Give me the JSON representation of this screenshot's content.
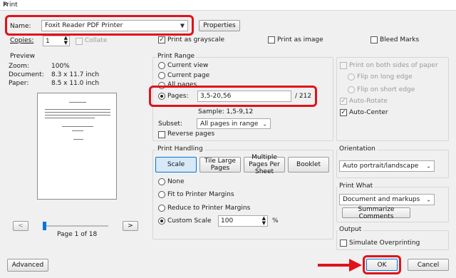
{
  "window": {
    "title": "Print",
    "close": "✕"
  },
  "printer": {
    "name_label": "Name:",
    "name_value": "Foxit Reader PDF Printer",
    "properties_label": "Properties",
    "copies_label": "Copies:",
    "copies_value": "1",
    "collate_label": "Collate",
    "grayscale_label": "Print as grayscale",
    "image_label": "Print as image",
    "bleed_label": "Bleed Marks"
  },
  "preview": {
    "title": "Preview",
    "zoom_label": "Zoom:",
    "zoom_value": "100%",
    "document_label": "Document:",
    "document_value": "8.3 x 11.7 inch",
    "paper_label": "Paper:",
    "paper_value": "8.5 x 11.0 inch",
    "prev_label": "<",
    "next_label": ">",
    "page_indicator": "Page 1 of 18"
  },
  "print_range": {
    "title": "Print Range",
    "current_view": "Current view",
    "current_page": "Current page",
    "all_pages": "All pages",
    "pages_label": "Pages:",
    "pages_value": "3,5-20,56",
    "pages_total": "/ 212",
    "sample": "Sample: 1,5-9,12",
    "subset_label": "Subset:",
    "subset_value": "All pages in range",
    "reverse_label": "Reverse pages"
  },
  "duplex": {
    "both_sides": "Print on both sides of paper",
    "long_edge": "Flip on long edge",
    "short_edge": "Flip on short edge",
    "auto_rotate": "Auto-Rotate",
    "auto_center": "Auto-Center"
  },
  "handling": {
    "title": "Print Handling",
    "tabs": [
      "Scale",
      "Tile Large Pages",
      "Multiple Pages Per Sheet",
      "Booklet"
    ],
    "none": "None",
    "fit": "Fit to Printer Margins",
    "reduce": "Reduce to Printer Margins",
    "custom": "Custom Scale",
    "custom_value": "100",
    "percent": "%"
  },
  "orientation": {
    "title": "Orientation",
    "value": "Auto portrait/landscape"
  },
  "print_what": {
    "title": "Print What",
    "value": "Document and markups",
    "summarize": "Summarize Comments"
  },
  "output": {
    "title": "Output",
    "simulate": "Simulate Overprinting"
  },
  "footer": {
    "advanced": "Advanced",
    "ok": "OK",
    "cancel": "Cancel"
  },
  "colors": {
    "highlight": "#e0131a",
    "accent": "#0078d7"
  }
}
